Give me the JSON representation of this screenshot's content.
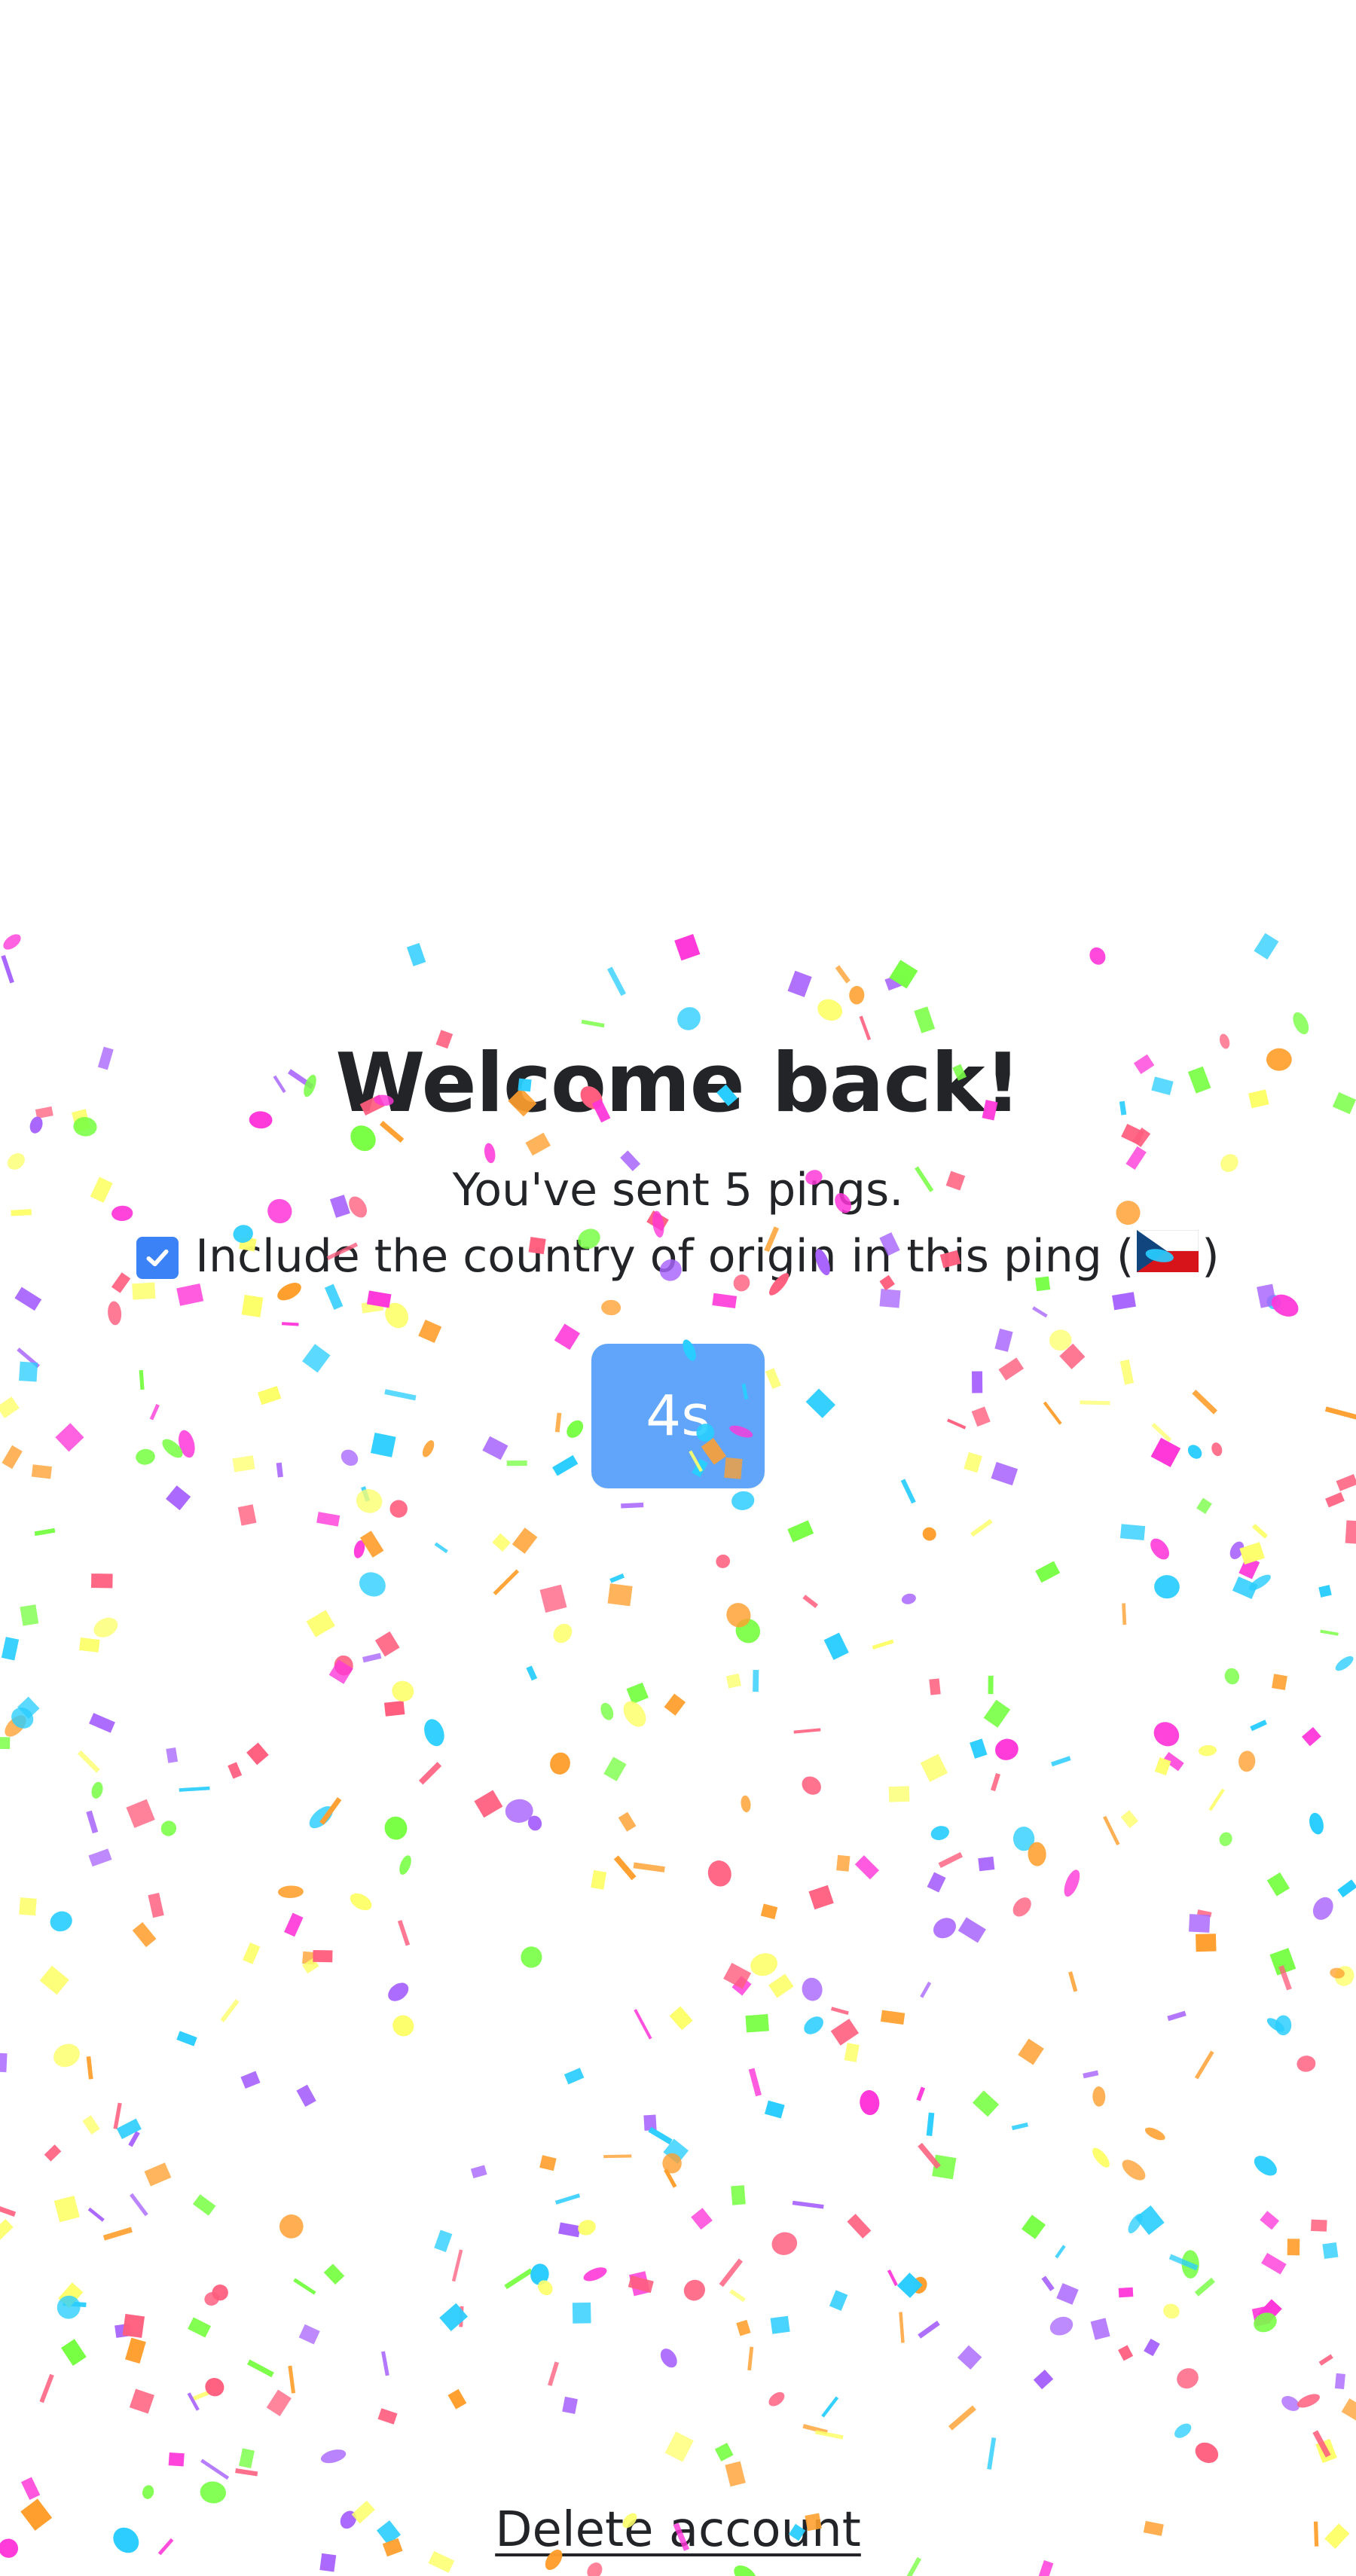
{
  "main": {
    "title": "Welcome back!",
    "subtitle": "You've sent 5 pings.",
    "country_option": {
      "label_before": "Include the country of origin in this ping (",
      "label_after": ")",
      "checked": true,
      "flag_icon": "czech-flag-icon"
    },
    "ping_button": {
      "label": "4s",
      "color": "#60a5fa"
    }
  },
  "footer": {
    "delete_label": "Delete account"
  },
  "colors": {
    "accent": "#3b82f6",
    "text": "#222428",
    "confetti": [
      "#ff5e7e",
      "#a864fd",
      "#29cdff",
      "#78ff44",
      "#fdff6a",
      "#ff9f2e",
      "#ff36d9"
    ]
  }
}
